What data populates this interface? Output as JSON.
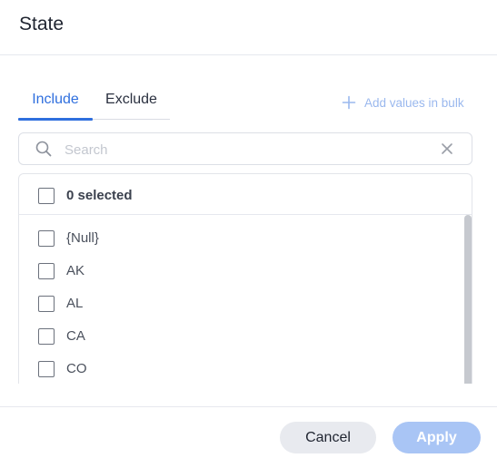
{
  "dialog": {
    "title": "State"
  },
  "tabs": [
    {
      "label": "Include",
      "active": true
    },
    {
      "label": "Exclude",
      "active": false
    }
  ],
  "bulk": {
    "label": "Add values in bulk",
    "icon": "plus-icon"
  },
  "search": {
    "placeholder": "Search",
    "value": "",
    "icon": "search-icon",
    "clear_icon": "close-icon"
  },
  "selection": {
    "summary": "0 selected",
    "checked": false
  },
  "items": [
    {
      "label": "{Null}",
      "checked": false
    },
    {
      "label": "AK",
      "checked": false
    },
    {
      "label": "AL",
      "checked": false
    },
    {
      "label": "CA",
      "checked": false
    },
    {
      "label": "CO",
      "checked": false
    }
  ],
  "footer": {
    "cancel_label": "Cancel",
    "apply_label": "Apply"
  },
  "colors": {
    "accent": "#2f6fde",
    "apply_disabled": "#a9c5f5",
    "cancel_bg": "#e8eaef",
    "bulk_link": "#9ab8ee"
  }
}
